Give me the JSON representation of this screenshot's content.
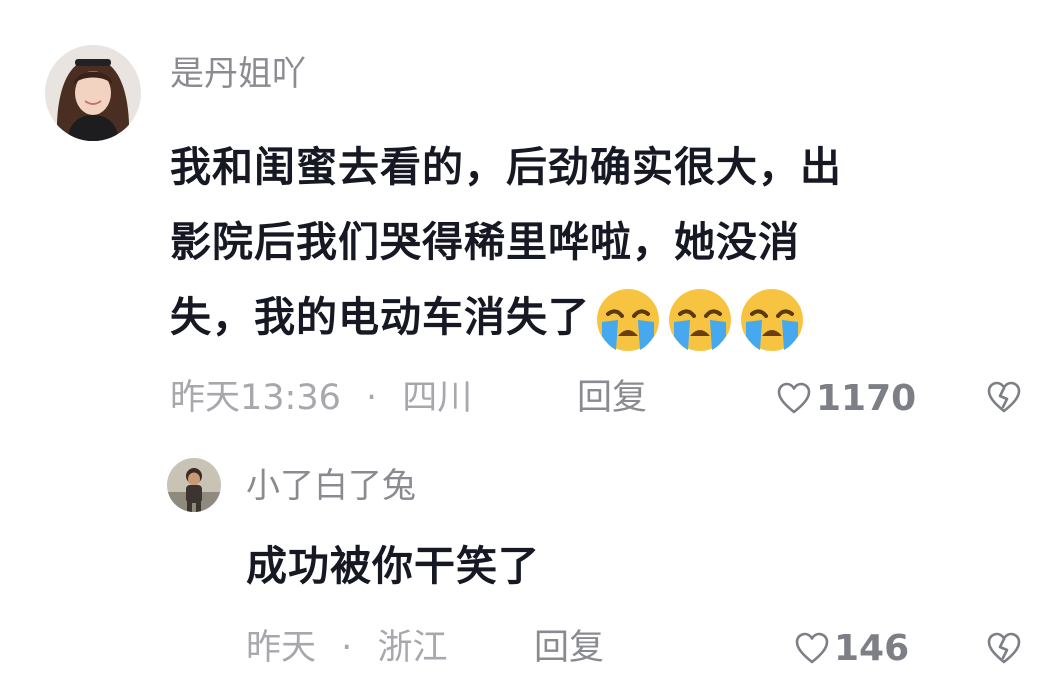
{
  "comments": [
    {
      "username": "是丹姐吖",
      "text_lines": [
        "我和闺蜜去看的，后劲确实很大，出",
        "影院后我们哭得稀里哗啦，她没消",
        "失，我的电动车消失了"
      ],
      "emoji": "loudly-crying-face",
      "time": "昨天13:36",
      "separator": "·",
      "location": "四川",
      "reply_label": "回复",
      "likes": "1170"
    },
    {
      "username": "小了白了兔",
      "text": "成功被你干笑了",
      "time": "昨天",
      "separator": "·",
      "location": "浙江",
      "reply_label": "回复",
      "likes": "146"
    }
  ],
  "icons": {
    "like": "heart-outline-icon",
    "dislike": "broken-heart-icon",
    "emoji": "loudly-crying-face"
  },
  "colors": {
    "text": "#161823",
    "username": "#8a8b91",
    "meta": "#a7a8ad"
  }
}
